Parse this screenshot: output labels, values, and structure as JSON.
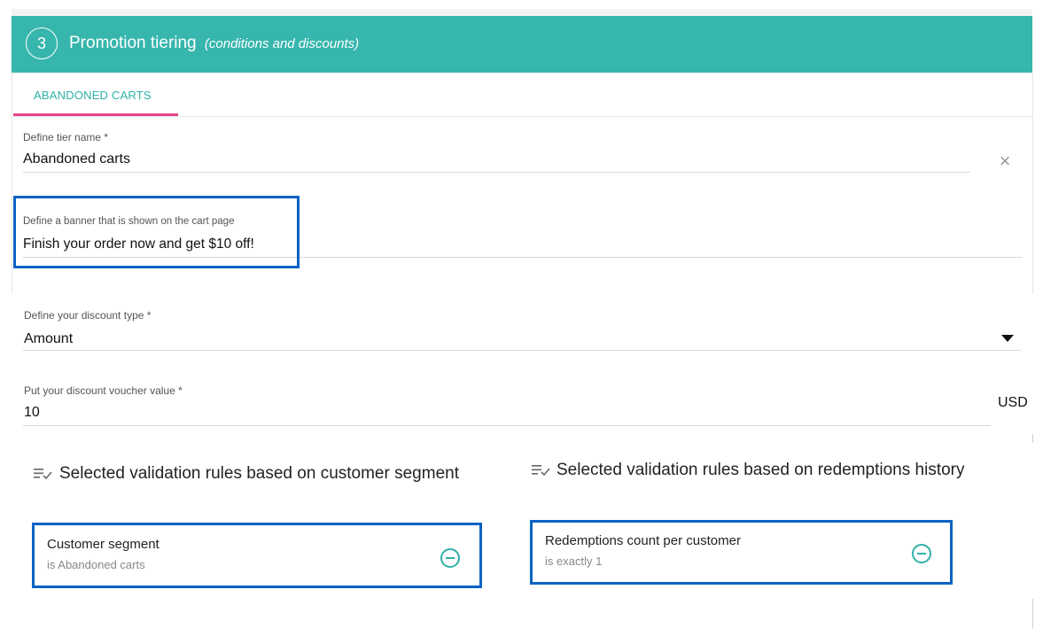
{
  "header": {
    "step_number": "3",
    "title": "Promotion tiering",
    "subtitle": "(conditions and discounts)",
    "color": "#37b6ad"
  },
  "tabs": [
    {
      "label": "ABANDONED CARTS",
      "active": true
    }
  ],
  "form": {
    "tier_name": {
      "label": "Define tier name *",
      "value": "Abandoned carts"
    },
    "banner": {
      "label": "Define a banner that is shown on the cart page",
      "value": "Finish your order now and get $10 off!"
    },
    "discount_type": {
      "label": "Define your discount type *",
      "value": "Amount"
    },
    "voucher_value": {
      "label": "Put your discount voucher value *",
      "value": "10",
      "currency": "USD"
    }
  },
  "validation": {
    "segment": {
      "title": "Selected validation rules based on customer segment",
      "rule": {
        "title": "Customer segment",
        "detail": "is Abandoned carts"
      }
    },
    "redemptions": {
      "title": "Selected validation rules based on redemptions history",
      "rule": {
        "title": "Redemptions count per customer",
        "detail": "is exactly 1"
      }
    }
  },
  "colors": {
    "accent": "#37b6ad",
    "tab_indicator": "#e8478f",
    "highlight": "#0b63c4"
  },
  "icons": {
    "clear": "close-icon",
    "dropdown": "caret-down-icon",
    "rules": "checklist-icon",
    "remove": "remove-circle-icon"
  }
}
